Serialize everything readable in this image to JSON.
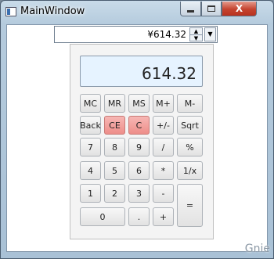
{
  "window": {
    "title": "MainWindow",
    "close_glyph": "X"
  },
  "dropdown": {
    "value": "¥614.32",
    "spin_up": "▲",
    "spin_down": "▼",
    "arrow": "▼"
  },
  "display": {
    "value": "614.32"
  },
  "keys": {
    "mc": "MC",
    "mr": "MR",
    "ms": "MS",
    "mplus": "M+",
    "mminus": "M-",
    "back": "Back",
    "ce": "CE",
    "c": "C",
    "plusminus": "+/-",
    "sqrt": "Sqrt",
    "n7": "7",
    "n8": "8",
    "n9": "9",
    "div": "/",
    "pct": "%",
    "n4": "4",
    "n5": "5",
    "n6": "6",
    "mul": "*",
    "recip": "1/x",
    "n1": "1",
    "n2": "2",
    "n3": "3",
    "sub": "-",
    "eq": "=",
    "n0": "0",
    "dot": ".",
    "add": "+"
  },
  "watermark": "Gnie",
  "colors": {
    "clear_keys": "#ee8e8a",
    "display_bg": "#e6f3ff"
  }
}
